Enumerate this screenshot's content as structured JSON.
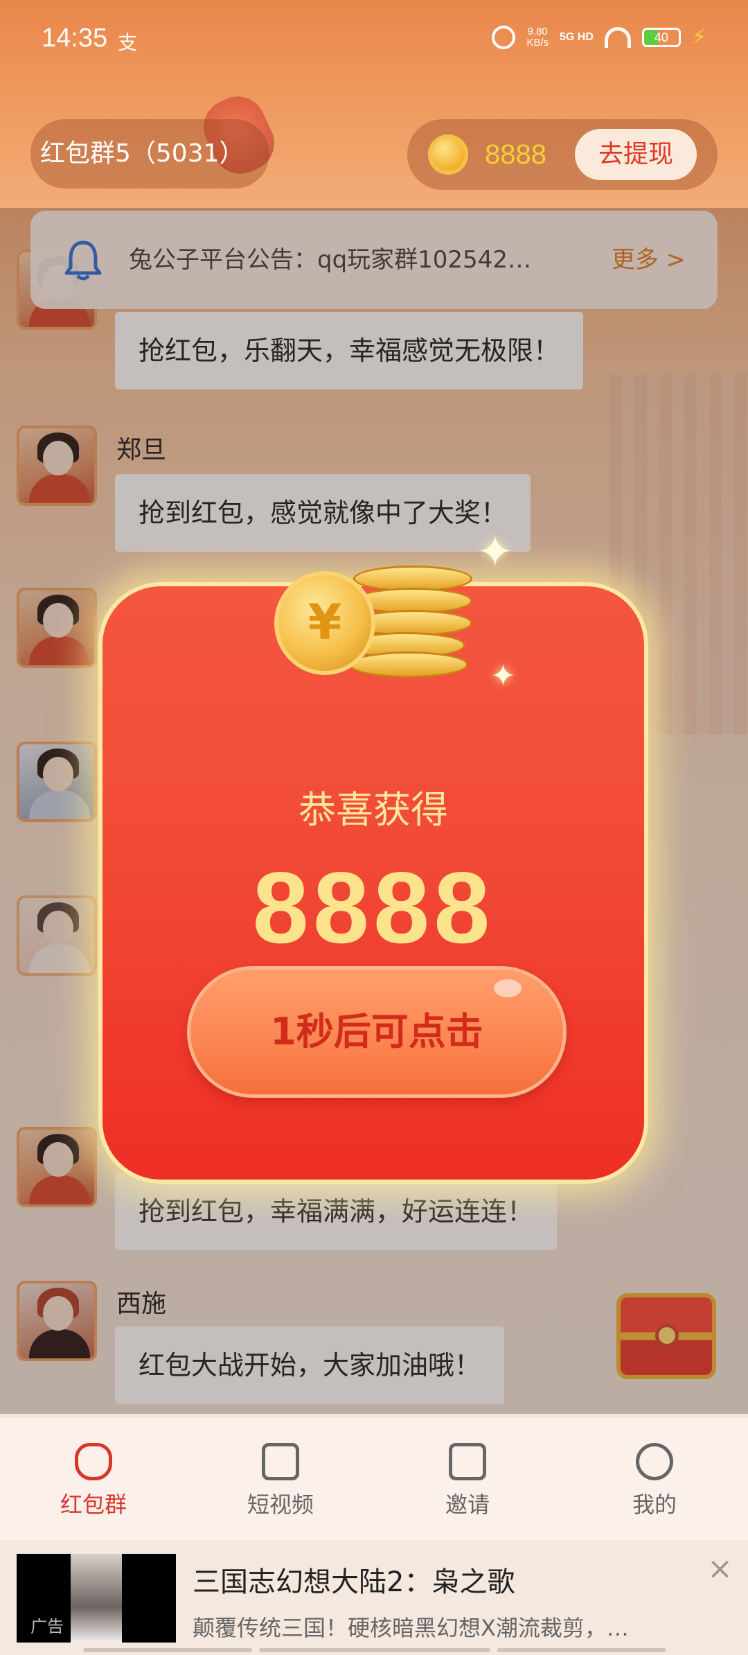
{
  "status_bar": {
    "time": "14:35",
    "alipay_glyph": "支",
    "net_speed_value": "9.80",
    "net_speed_unit": "KB/s",
    "network": "5G HD",
    "battery": "40"
  },
  "header": {
    "group_name": "红包群5（5031）",
    "coin_amount": "8888",
    "withdraw_label": "去提现"
  },
  "notice": {
    "text": "兔公子平台公告：qq玩家群102542…",
    "more_label": "更多 >"
  },
  "chat": {
    "messages": [
      {
        "name": "",
        "text": "抢红包，乐翻天，幸福感觉无极限！"
      },
      {
        "name": "郑旦",
        "text": "抢到红包，感觉就像中了大奖！"
      },
      {
        "name": "",
        "text": "抢到红包，幸福满满，好运连连！"
      },
      {
        "name": "西施",
        "text": "红包大战开始，大家加油哦！"
      }
    ]
  },
  "popup": {
    "title": "恭喜获得",
    "amount": "8888",
    "button_label": "1秒后可点击",
    "coin_symbol": "¥"
  },
  "tabbar": {
    "items": [
      {
        "label": "红包群",
        "icon": "red-envelope-bag-icon",
        "active": true
      },
      {
        "label": "短视频",
        "icon": "video-play-icon",
        "active": false
      },
      {
        "label": "邀请",
        "icon": "chart-bars-icon",
        "active": false
      },
      {
        "label": "我的",
        "icon": "profile-icon",
        "active": false
      }
    ]
  },
  "ad": {
    "badge": "广告",
    "title": "三国志幻想大陆2：枭之歌",
    "description": "颠覆传统三国！硬核暗黑幻想X潮流裁剪，…",
    "close_glyph": "×"
  },
  "colors": {
    "accent_red": "#d9362a",
    "coin_yellow": "#f6cf39",
    "popup_red": "#f14a37"
  }
}
